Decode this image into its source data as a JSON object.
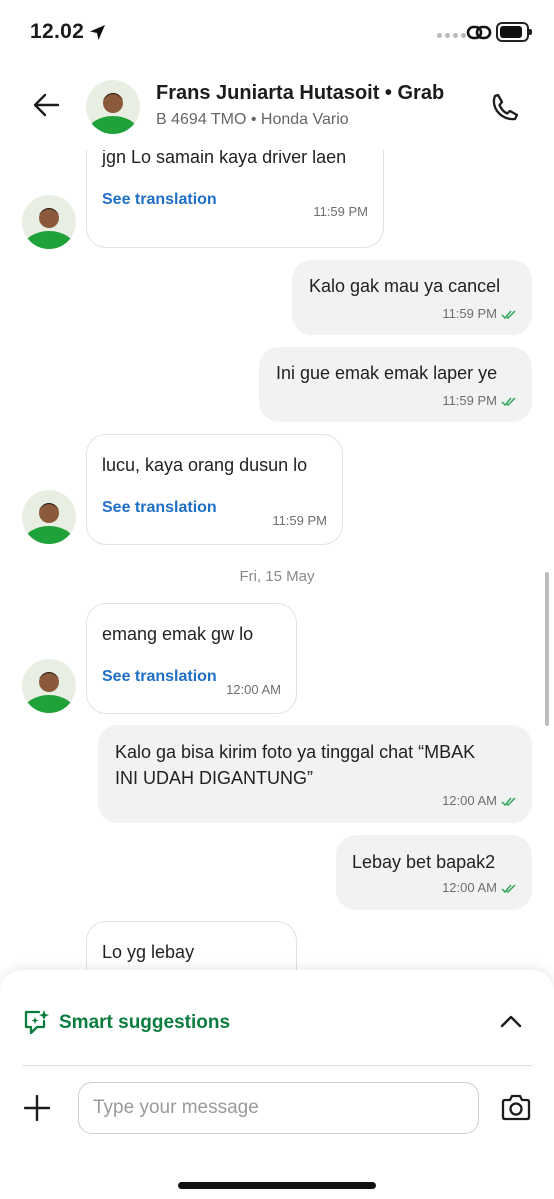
{
  "status_bar": {
    "time": "12.02"
  },
  "header": {
    "name": "Frans Juniarta Hutasoit • Grab",
    "subtitle": "B 4694 TMO • Honda Vario"
  },
  "messages": [
    {
      "dir": "in",
      "text": "jgn Lo samain kaya driver laen",
      "translate": "See translation",
      "time": "11:59 PM"
    },
    {
      "dir": "out",
      "text": "Kalo gak mau ya cancel",
      "time": "11:59 PM"
    },
    {
      "dir": "out",
      "text": "Ini gue emak emak laper ye",
      "time": "11:59 PM"
    },
    {
      "dir": "in",
      "text": "lucu, kaya orang dusun lo",
      "translate": "See translation",
      "time": "11:59 PM"
    },
    {
      "dir": "in",
      "text": "emang emak gw lo",
      "translate": "See translation",
      "time": "12:00 AM"
    },
    {
      "dir": "out",
      "text": "Kalo ga bisa kirim foto ya tinggal chat “MBAK\nINI UDAH DIGANTUNG”",
      "time": "12:00 AM"
    },
    {
      "dir": "out",
      "text": "Lebay bet bapak2",
      "time": "12:00 AM"
    },
    {
      "dir": "in",
      "text": "Lo yg lebay"
    }
  ],
  "date_separator": "Fri, 15 May",
  "composer": {
    "smart_suggestions": "Smart suggestions",
    "placeholder": "Type your message"
  },
  "colors": {
    "accent_green": "#0a7d3e",
    "link_blue": "#1f6fc6",
    "tick_green": "#2fa35a"
  }
}
